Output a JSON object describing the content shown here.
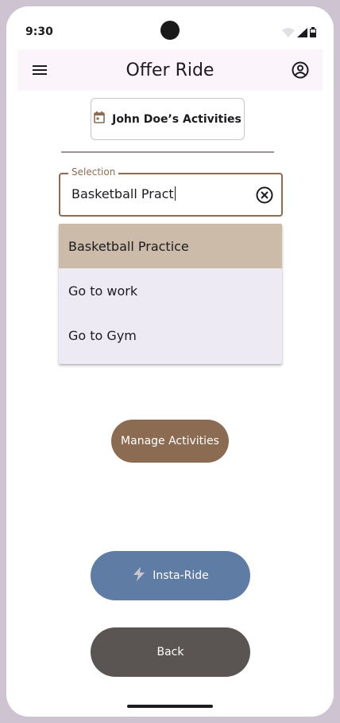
{
  "status_bar": {
    "time": "9:30"
  },
  "app_bar": {
    "title": "Offer Ride",
    "menu_icon": "menu-icon",
    "account_icon": "account-circle-icon"
  },
  "activities_button": {
    "label": "John Doe’s Activities",
    "icon": "calendar-icon"
  },
  "selection": {
    "label": "Selection",
    "value": "Basketball Pract",
    "clear_icon": "clear-circle-icon"
  },
  "dropdown": {
    "items": [
      {
        "label": "Basketball Practice",
        "selected": true
      },
      {
        "label": "Go to work",
        "selected": false
      },
      {
        "label": "Go to Gym",
        "selected": false
      }
    ]
  },
  "buttons": {
    "manage": "Manage Activities",
    "insta": "Insta-Ride",
    "insta_icon": "bolt-icon",
    "back": "Back"
  },
  "colors": {
    "accent_brown": "#8b6c52",
    "selected_item": "#cbbba8",
    "insta_blue": "#5f7ca4",
    "back_gray": "#5a5553",
    "app_bar_bg": "#fcf4fb",
    "dropdown_bg": "#eeeaf4"
  }
}
